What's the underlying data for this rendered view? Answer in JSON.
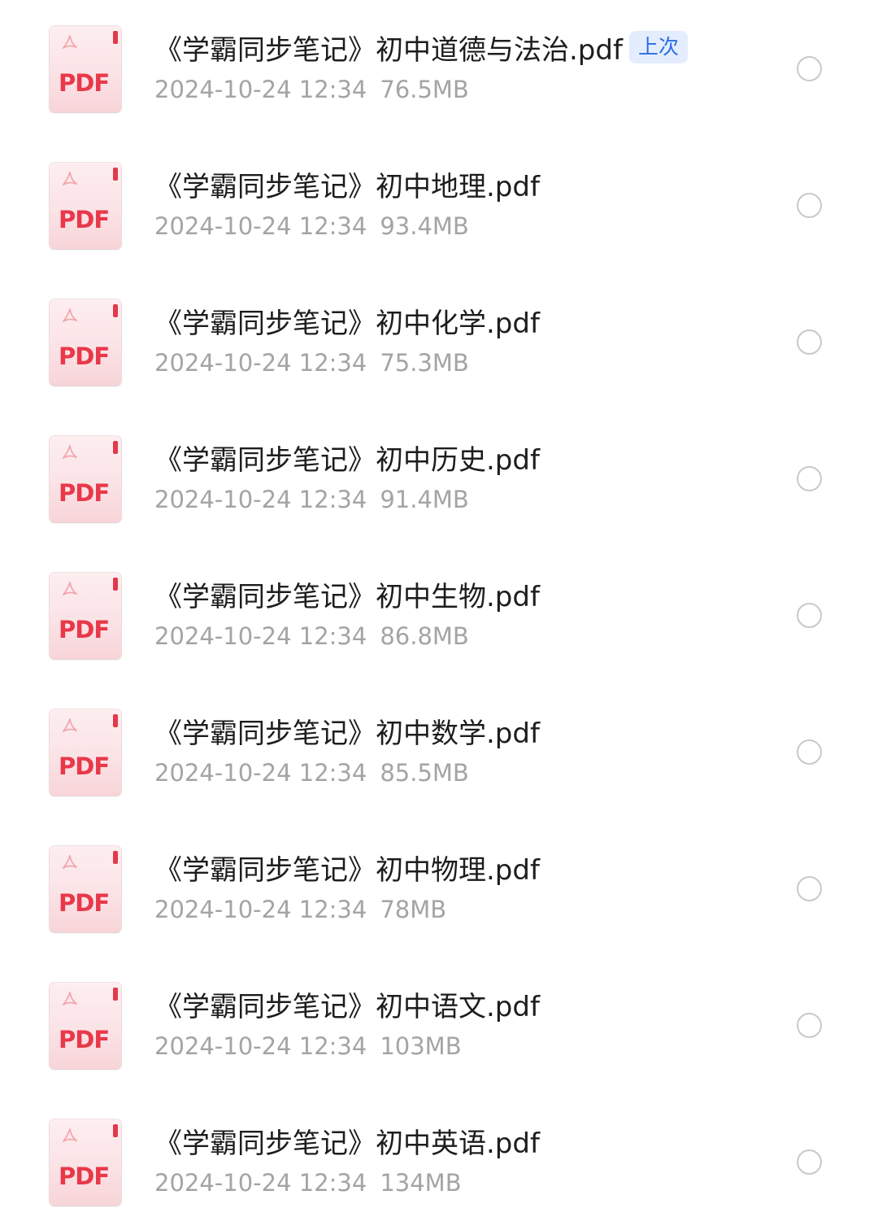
{
  "files": [
    {
      "name": "《学霸同步笔记》初中道德与法治.pdf",
      "date": "2024-10-24 12:34",
      "size": "76.5MB",
      "badge": "上次",
      "icon_text": "PDF",
      "icon": "pdf-file-icon"
    },
    {
      "name": "《学霸同步笔记》初中地理.pdf",
      "date": "2024-10-24 12:34",
      "size": "93.4MB",
      "icon_text": "PDF",
      "icon": "pdf-file-icon"
    },
    {
      "name": "《学霸同步笔记》初中化学.pdf",
      "date": "2024-10-24 12:34",
      "size": "75.3MB",
      "icon_text": "PDF",
      "icon": "pdf-file-icon"
    },
    {
      "name": "《学霸同步笔记》初中历史.pdf",
      "date": "2024-10-24 12:34",
      "size": "91.4MB",
      "icon_text": "PDF",
      "icon": "pdf-file-icon"
    },
    {
      "name": "《学霸同步笔记》初中生物.pdf",
      "date": "2024-10-24 12:34",
      "size": "86.8MB",
      "icon_text": "PDF",
      "icon": "pdf-file-icon"
    },
    {
      "name": "《学霸同步笔记》初中数学.pdf",
      "date": "2024-10-24 12:34",
      "size": "85.5MB",
      "icon_text": "PDF",
      "icon": "pdf-file-icon"
    },
    {
      "name": "《学霸同步笔记》初中物理.pdf",
      "date": "2024-10-24 12:34",
      "size": "78MB",
      "icon_text": "PDF",
      "icon": "pdf-file-icon"
    },
    {
      "name": "《学霸同步笔记》初中语文.pdf",
      "date": "2024-10-24 12:34",
      "size": "103MB",
      "icon_text": "PDF",
      "icon": "pdf-file-icon"
    },
    {
      "name": "《学霸同步笔记》初中英语.pdf",
      "date": "2024-10-24 12:34",
      "size": "134MB",
      "icon_text": "PDF",
      "icon": "pdf-file-icon"
    }
  ],
  "colors": {
    "pdf_red": "#e8384a",
    "badge_bg": "#e4edfe",
    "badge_text": "#2b6de5",
    "meta_gray": "#a4a4a4"
  }
}
